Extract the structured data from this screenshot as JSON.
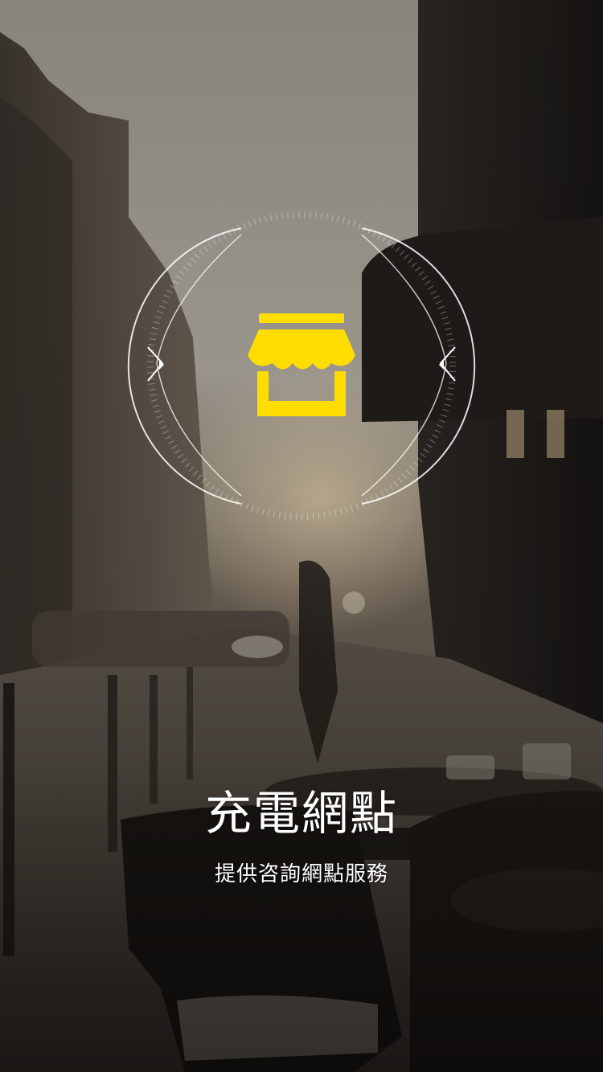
{
  "splash": {
    "title": "充電網點",
    "subtitle": "提供咨詢網點服務"
  },
  "icon": {
    "name": "store-icon",
    "color": "#FFDD00"
  },
  "colors": {
    "text": "#FFFFFF",
    "accent": "#FFDD00"
  }
}
